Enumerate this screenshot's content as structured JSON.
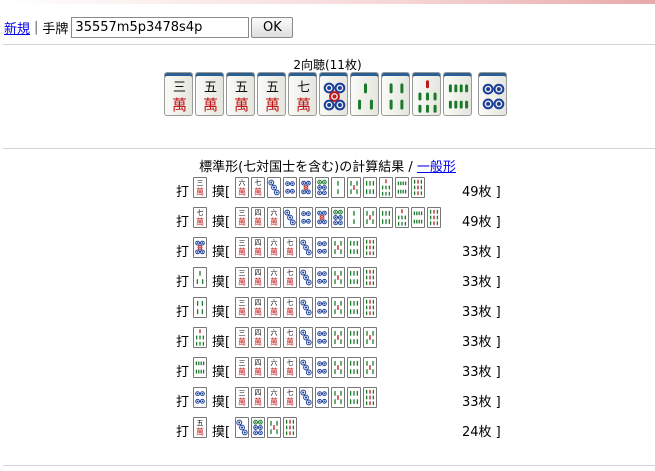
{
  "toolbar": {
    "new_link": "新規",
    "separator": "|",
    "hand_label": "手牌",
    "hand_value": "35557m5p3478s4p",
    "ok_label": "OK"
  },
  "shanten_text": "2向聴(11枚)",
  "hand_tiles": [
    "3m",
    "5m",
    "5m",
    "5m",
    "7m",
    "5p",
    "3s",
    "4s",
    "7s",
    "8s",
    "4p"
  ],
  "results_title": "標準形(七対国士を含む)の計算結果",
  "results_separator": "/",
  "general_link": "一般形",
  "discard_label": "打",
  "draw_label": "摸[",
  "rows": [
    {
      "discard": "3m",
      "draws": [
        "6m",
        "7m",
        "3p",
        "4p",
        "5p",
        "6p",
        "2s",
        "5s",
        "6s",
        "7s",
        "8s",
        "9s"
      ],
      "count": "49枚 ]"
    },
    {
      "discard": "7m",
      "draws": [
        "3m",
        "4m",
        "6m",
        "3p",
        "4p",
        "5p",
        "6p",
        "2s",
        "5s",
        "6s",
        "7s",
        "8s",
        "9s"
      ],
      "count": "49枚 ]"
    },
    {
      "discard": "5p",
      "draws": [
        "3m",
        "4m",
        "6m",
        "7m",
        "3p",
        "4p",
        "5s",
        "6s",
        "9s"
      ],
      "count": "33枚 ]"
    },
    {
      "discard": "3s",
      "draws": [
        "3m",
        "4m",
        "6m",
        "7m",
        "3p",
        "4p",
        "5s",
        "6s",
        "9s"
      ],
      "count": "33枚 ]"
    },
    {
      "discard": "4s",
      "draws": [
        "3m",
        "4m",
        "6m",
        "7m",
        "3p",
        "4p",
        "5s",
        "6s",
        "9s"
      ],
      "count": "33枚 ]"
    },
    {
      "discard": "7s",
      "draws": [
        "3m",
        "4m",
        "6m",
        "7m",
        "3p",
        "4p",
        "5s",
        "6s",
        "5s"
      ],
      "count": "33枚 ]"
    },
    {
      "discard": "8s",
      "draws": [
        "3m",
        "4m",
        "6m",
        "7m",
        "3p",
        "4p",
        "5s",
        "6s",
        "5s"
      ],
      "count": "33枚 ]"
    },
    {
      "discard": "4p",
      "draws": [
        "3m",
        "4m",
        "6m",
        "7m",
        "3p",
        "4p",
        "5s",
        "6s",
        "9s"
      ],
      "count": "33枚 ]"
    },
    {
      "discard": "5m",
      "draws": [
        "3p",
        "6p",
        "5s",
        "9s"
      ],
      "count": "24枚 ]"
    }
  ]
}
